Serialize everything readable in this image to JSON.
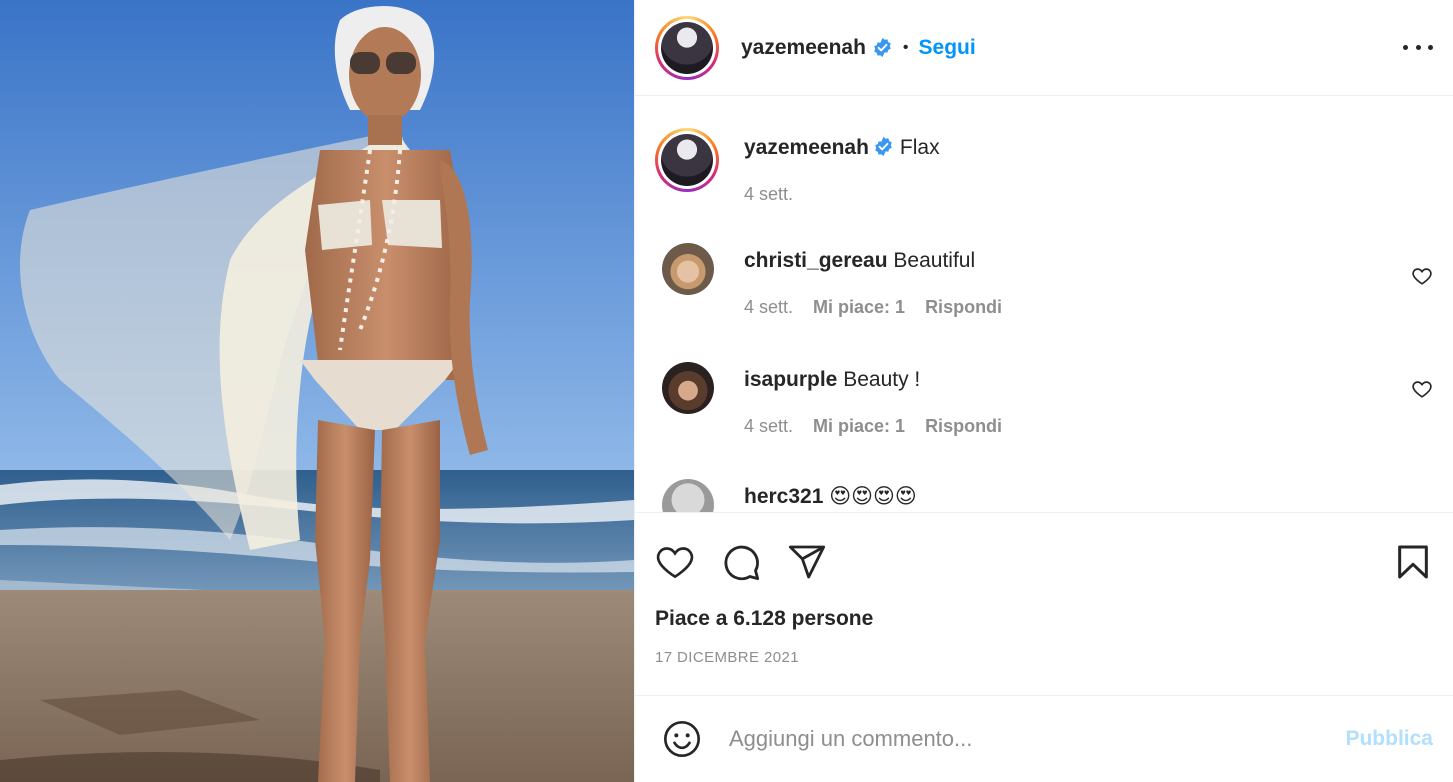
{
  "post": {
    "author": {
      "username": "yazemeenah",
      "verified": true,
      "follow_label": "Segui",
      "separator": "•"
    },
    "caption": {
      "username": "yazemeenah",
      "text": "Flax",
      "time": "4 sett."
    },
    "comments": [
      {
        "username": "christi_gereau",
        "text": "Beautiful",
        "time": "4 sett.",
        "likes": "Mi piace: 1",
        "reply_label": "Rispondi"
      },
      {
        "username": "isapurple",
        "text": "Beauty !",
        "time": "4 sett.",
        "likes": "Mi piace: 1",
        "reply_label": "Rispondi"
      },
      {
        "username": "herc321",
        "text": "😍😍😍😍"
      }
    ],
    "likes_text": "Piace a 6.128 persone",
    "date": "17 DICEMBRE 2021",
    "add_comment": {
      "placeholder": "Aggiungi un commento...",
      "publish_label": "Pubblica"
    },
    "icons": {
      "more": "more-options-icon",
      "like": "heart-icon",
      "comment": "comment-bubble-icon",
      "share": "paper-plane-icon",
      "save": "bookmark-icon",
      "emoji": "smiley-icon",
      "verified": "verified-badge-icon"
    },
    "colors": {
      "accent": "#0095f6",
      "accent_disabled": "#b2dffc",
      "verified": "#3897f0",
      "muted": "#8e8e8e",
      "text": "#262626"
    }
  }
}
